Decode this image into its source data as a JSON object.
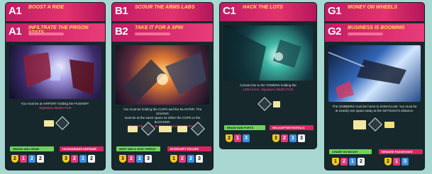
{
  "cards": [
    {
      "id": "card-a",
      "headers": [
        {
          "code": "A1",
          "title": "BOOST A RIDE"
        },
        {
          "code": "A1",
          "title": "INFILTRATE THE PRISON STATS"
        }
      ],
      "text_lines": [
        "You must be at AIRPORT holding the PUSHER*.",
        "Signature OBJECTIVE"
      ],
      "bars": [
        {
          "label": "SMASH AND GRAB",
          "color": "green"
        },
        {
          "label": "HOODWINKER DEFENSE",
          "color": "pink"
        }
      ],
      "pips_left": [
        "2",
        "1",
        "2",
        "2"
      ],
      "pips_right": [
        "3",
        "2",
        "1",
        "2"
      ]
    },
    {
      "id": "card-b",
      "headers": [
        {
          "code": "B1",
          "title": "SCOUR THE ARMS LABS"
        },
        {
          "code": "B2",
          "title": "TAKE IT FOR A SPIN"
        }
      ],
      "text_lines": [
        "You must be holding the CLIPS and the BLASTER. The SAVANG",
        "must be at the same space as either the COPS or the BLOCKER.",
        "BEAT THE COPS, BUY THE HEIST BACKPACK"
      ],
      "bars": [
        {
          "label": "MEET WIN & GIVE THREAT",
          "color": "green"
        },
        {
          "label": "INTERCEPT ESCAPE",
          "color": "pink"
        }
      ],
      "pips_left": [
        "3",
        "2",
        "2",
        "3"
      ],
      "pips_right": [
        "1",
        "2",
        "2",
        "3"
      ]
    },
    {
      "id": "card-c",
      "headers": [
        {
          "code": "C1",
          "title": "HACK THE LOTS"
        }
      ],
      "text_lines": [
        "Connect be to the TOWERS holding the",
        "USB HACK. Signature OBJECTIVE"
      ],
      "bars": [
        {
          "label": "BRAIN HUB PORTS",
          "color": "green"
        },
        {
          "label": "HELICOPTER PATROLS",
          "color": "pink"
        }
      ],
      "pips_left": [
        "2",
        "1",
        "3"
      ],
      "pips_right": [
        "3",
        "2",
        "1",
        "3"
      ]
    },
    {
      "id": "card-g",
      "headers": [
        {
          "code": "G1",
          "title": "MONEY ON WHEELS"
        },
        {
          "code": "G2",
          "title": "BUSINESS IS BOOMING"
        }
      ],
      "text_lines": [
        "The GOBBERS must be home to ZONACLUB. You must be",
        "at exactly one space away at the SETSUKO's distance."
      ],
      "bars": [
        {
          "label": "CHASE ON BOOST",
          "color": "green"
        },
        {
          "label": "BEWARE PASSENGER",
          "color": "pink"
        }
      ],
      "pips_left": [
        "1",
        "2",
        "1",
        "2"
      ],
      "pips_right": [
        "2",
        "1",
        "3"
      ]
    }
  ]
}
